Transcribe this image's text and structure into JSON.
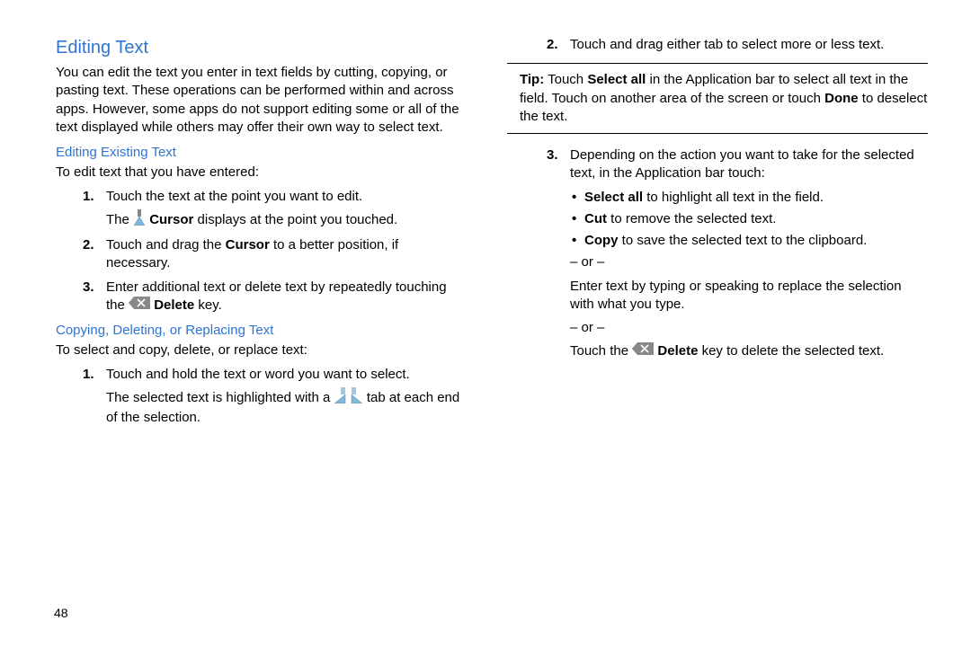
{
  "pageNumber": "48",
  "left": {
    "h_main": "Editing Text",
    "intro": "You can edit the text you enter in text fields by cutting, copying, or pasting text. These operations can be performed within and across apps. However, some apps do not support editing some or all of the text displayed while others may offer their own way to select text.",
    "h_sub1": "Editing Existing Text",
    "lead1": "To edit text that you have entered:",
    "s1_num": "1.",
    "s1_a": "Touch the text at the point you want to edit.",
    "s1_b_pre": "The ",
    "s1_b_bold": "Cursor",
    "s1_b_post": " displays at the point you touched.",
    "s2_num": "2.",
    "s2_pre": "Touch and drag the ",
    "s2_b": "Cursor",
    "s2_post": " to a better position, if necessary.",
    "s3_num": "3.",
    "s3_pre": "Enter additional text or delete text by repeatedly touching the ",
    "s3_b": "Delete",
    "s3_post": " key.",
    "h_sub2": "Copying, Deleting, or Replacing Text",
    "lead2": "To select and copy, delete, or replace text:",
    "c1_num": "1.",
    "c1_a": "Touch and hold the text or word you want to select.",
    "c1_b_pre": "The selected text is highlighted with a ",
    "c1_b_post": " tab at each end of the selection."
  },
  "right": {
    "r2_num": "2.",
    "r2": "Touch and drag either tab to select more or less text.",
    "tip_label": "Tip:",
    "tip_pre": " Touch ",
    "tip_b1": "Select all",
    "tip_mid": " in the Application bar to select all text in the field. Touch on another area of the screen or touch ",
    "tip_b2": "Done",
    "tip_post": " to deselect the text.",
    "r3_num": "3.",
    "r3": "Depending on the action you want to take for the selected text, in the Application bar touch:",
    "b1_b": "Select all",
    "b1_post": " to highlight all text in the field.",
    "b2_b": "Cut",
    "b2_post": " to remove the selected text.",
    "b3_b": "Copy",
    "b3_post": " to save the selected text to the clipboard.",
    "or": "– or –",
    "enter_text": "Enter text by typing or speaking to replace the selection with what you type.",
    "touch_pre": "Touch the ",
    "touch_b": "Delete",
    "touch_post": " key to delete the selected text."
  }
}
